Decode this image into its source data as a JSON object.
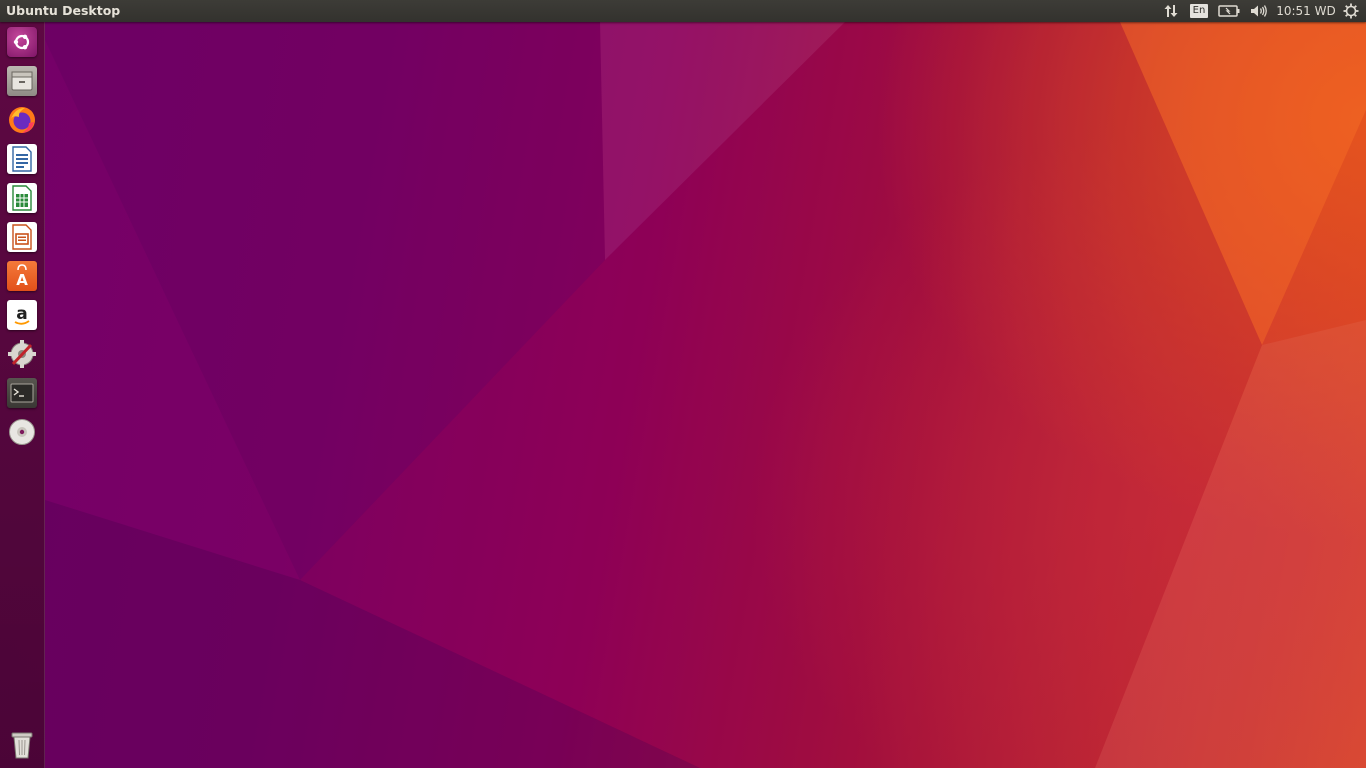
{
  "top_panel": {
    "title": "Ubuntu Desktop",
    "indicators": {
      "network_icon": "network-up-down-icon",
      "keyboard_layout": "En",
      "battery_icon": "battery-icon",
      "sound_icon": "volume-icon",
      "clock": "10:51 WD",
      "session_icon": "gear-power-icon"
    }
  },
  "launcher": {
    "items": [
      {
        "name": "Search your computer",
        "icon": "ubuntu-dash-icon"
      },
      {
        "name": "Files",
        "icon": "files-icon"
      },
      {
        "name": "Firefox Web Browser",
        "icon": "firefox-icon"
      },
      {
        "name": "LibreOffice Writer",
        "icon": "libreoffice-writer-icon"
      },
      {
        "name": "LibreOffice Calc",
        "icon": "libreoffice-calc-icon"
      },
      {
        "name": "LibreOffice Impress",
        "icon": "libreoffice-impress-icon"
      },
      {
        "name": "Ubuntu Software",
        "icon": "ubuntu-software-icon"
      },
      {
        "name": "Amazon",
        "icon": "amazon-icon"
      },
      {
        "name": "System Settings",
        "icon": "system-settings-icon"
      },
      {
        "name": "Terminal",
        "icon": "terminal-icon"
      },
      {
        "name": "DVD",
        "icon": "dvd-icon"
      }
    ],
    "trash": {
      "name": "Trash",
      "icon": "trash-icon"
    }
  },
  "colors": {
    "panel_bg": "#3d3c37",
    "wallpaper_left": "#740068",
    "wallpaper_right": "#d84024"
  }
}
